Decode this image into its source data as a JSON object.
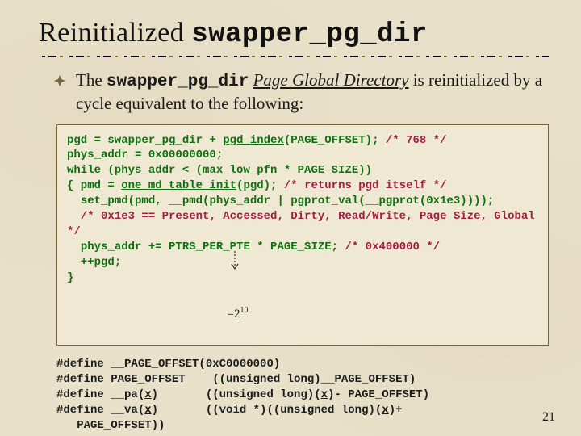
{
  "title": {
    "prefix": "Reinitialized ",
    "mono": "swapper_pg_dir"
  },
  "bullet": {
    "pre": "The ",
    "mono": "swapper_pg_dir",
    "mid": " ",
    "term": "Page Global Directory",
    "post": " is reinitialized by a cycle equivalent to the following:"
  },
  "code": {
    "l1a": "pgd = swapper_pg_dir + ",
    "l1b": "pgd_index",
    "l1c": "(PAGE_OFFSET);",
    "l1d": " /* 768 */",
    "l2": "phys_addr = 0x00000000;",
    "l3": "while (phys_addr < (max_low_pfn * PAGE_SIZE))",
    "l4a": "{ pmd = ",
    "l4b": "one_md_table_init",
    "l4c": "(pgd);",
    "l4d": " /* returns pgd itself */",
    "l5": "  set_pmd(pmd, __pmd(phys_addr | pgprot_val(__pgprot(0x1e3))));",
    "l6": "  /* 0x1e3 == Present, Accessed, Dirty, Read/Write, Page Size, Global */",
    "l7a": "  phys_addr += PTRS_PER_PTE * PAGE_SIZE;",
    "l7b": " /* 0x400000 */",
    "l8": "  ++pgd;",
    "l9": "}"
  },
  "annotation": {
    "eq": "=2",
    "exp": "10"
  },
  "defs": {
    "d1": "#define __PAGE_OFFSET(0xC0000000)",
    "d2a": "#define PAGE_OFFSET    ((unsigned long)__PAGE_OFFSET)",
    "d3a": "#define __pa(",
    "d3u": "x",
    "d3b": ")       ((unsigned long)(",
    "d3u2": "x",
    "d3c": ")- PAGE_OFFSET)",
    "d4a": "#define __va(",
    "d4u": "x",
    "d4b": ")       ((void *)((unsigned long)(",
    "d4u2": "x",
    "d4c": ")+",
    "d5": "   PAGE_OFFSET))"
  },
  "page_number": "21"
}
